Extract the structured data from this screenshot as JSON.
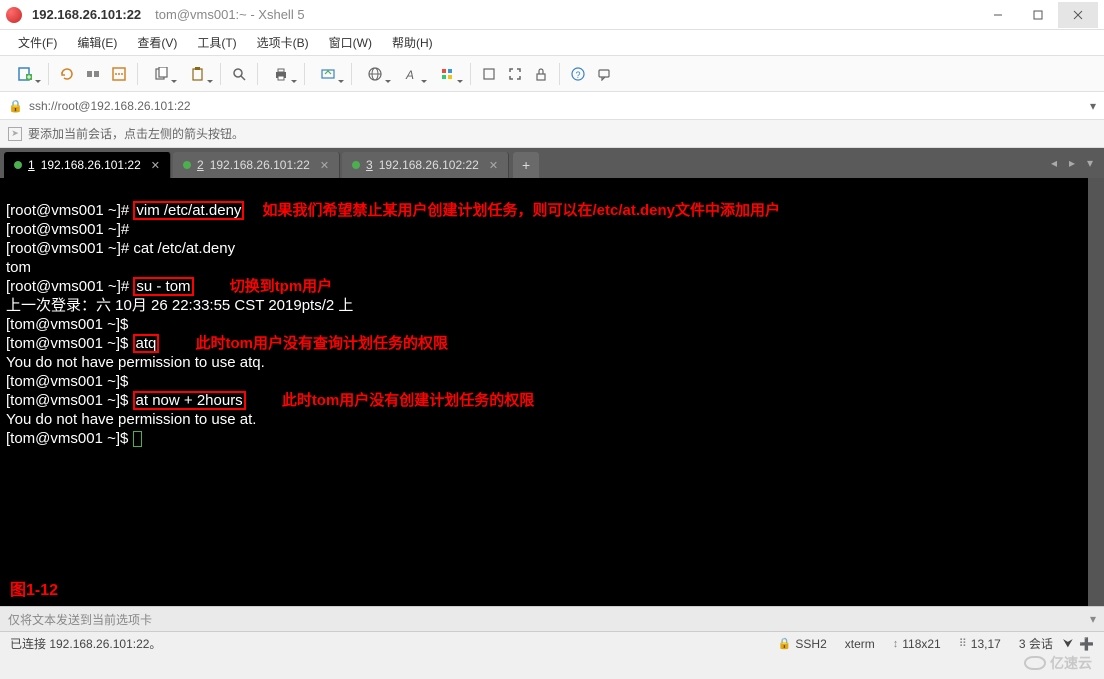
{
  "title": {
    "main": "192.168.26.101:22",
    "sub": "tom@vms001:~ - Xshell 5"
  },
  "menus": {
    "file": "文件(F)",
    "edit": "编辑(E)",
    "view": "查看(V)",
    "tools": "工具(T)",
    "tabs": "选项卡(B)",
    "window": "窗口(W)",
    "help": "帮助(H)"
  },
  "address": "ssh://root@192.168.26.101:22",
  "hint": "要添加当前会话，点击左侧的箭头按钮。",
  "tabs": [
    {
      "num": "1",
      "label": "192.168.26.101:22",
      "active": true
    },
    {
      "num": "2",
      "label": "192.168.26.101:22",
      "active": false
    },
    {
      "num": "3",
      "label": "192.168.26.102:22",
      "active": false
    }
  ],
  "term": {
    "p_root": "[root@vms001 ~]# ",
    "p_tom": "[tom@vms001 ~]$ ",
    "cmd_vim": "vim /etc/at.deny",
    "ann_vim": "如果我们希望禁止某用户创建计划任务，则可以在/etc/at.deny文件中添加用户",
    "cmd_cat": "cat /etc/at.deny",
    "out_cat": "tom",
    "cmd_su": "su - tom",
    "ann_su": "切换到tpm用户",
    "out_login": "上一次登录：六 10月 26 22:33:55 CST 2019pts/2 上",
    "cmd_atq": "atq",
    "ann_atq": "此时tom用户没有查询计划任务的权限",
    "out_atq": "You do not have permission to use atq.",
    "cmd_at": "at now + 2hours",
    "ann_at": "此时tom用户没有创建计划任务的权限",
    "out_at": "You do not have permission to use at.",
    "fig": "图1-12"
  },
  "sendbar": "仅将文本发送到当前选项卡",
  "status": {
    "conn": "已连接 192.168.26.101:22。",
    "proto": "SSH2",
    "term": "xterm",
    "size": "118x21",
    "pos": "13,17",
    "sessions": "3 会话"
  },
  "watermark": "亿速云"
}
